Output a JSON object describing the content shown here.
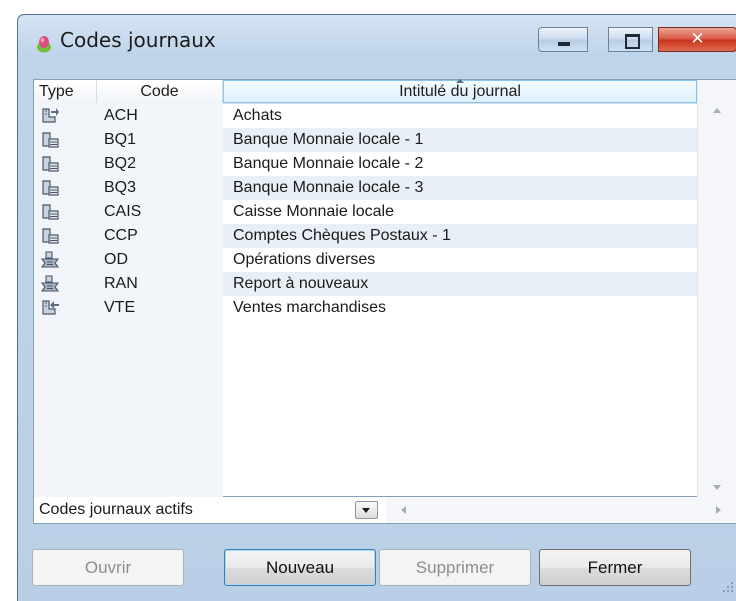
{
  "window": {
    "title": "Codes journaux",
    "buttons": {
      "minimize": "minimize",
      "maximize": "maximize",
      "close": "✕"
    }
  },
  "list": {
    "columns": {
      "type": "Type",
      "code": "Code",
      "intitule": "Intitulé du journal"
    },
    "sorted_column": "intitule",
    "rows": [
      {
        "type_icon": "purchase-journal-icon",
        "code": "ACH",
        "intitule": "Achats"
      },
      {
        "type_icon": "bank-journal-icon",
        "code": "BQ1",
        "intitule": "Banque Monnaie locale - 1"
      },
      {
        "type_icon": "bank-journal-icon",
        "code": "BQ2",
        "intitule": "Banque Monnaie locale - 2"
      },
      {
        "type_icon": "bank-journal-icon",
        "code": "BQ3",
        "intitule": "Banque Monnaie locale - 3"
      },
      {
        "type_icon": "bank-journal-icon",
        "code": "CAIS",
        "intitule": "Caisse Monnaie locale"
      },
      {
        "type_icon": "bank-journal-icon",
        "code": "CCP",
        "intitule": "Comptes Chèques Postaux - 1"
      },
      {
        "type_icon": "general-journal-icon",
        "code": "OD",
        "intitule": "Opérations diverses"
      },
      {
        "type_icon": "general-journal-icon",
        "code": "RAN",
        "intitule": "Report à nouveaux"
      },
      {
        "type_icon": "sales-journal-icon",
        "code": "VTE",
        "intitule": "Ventes marchandises"
      }
    ]
  },
  "filter": {
    "selected": "Codes journaux actifs"
  },
  "buttons": {
    "ouvrir": "Ouvrir",
    "nouveau": "Nouveau",
    "supprimer": "Supprimer",
    "fermer": "Fermer"
  },
  "colors": {
    "window_frame": "#b9cfe7",
    "row_alt": "#e9eff7",
    "header_sorted": "#dcf0fc",
    "close_button": "#c8311a",
    "default_button_border": "#3c7fb1"
  }
}
